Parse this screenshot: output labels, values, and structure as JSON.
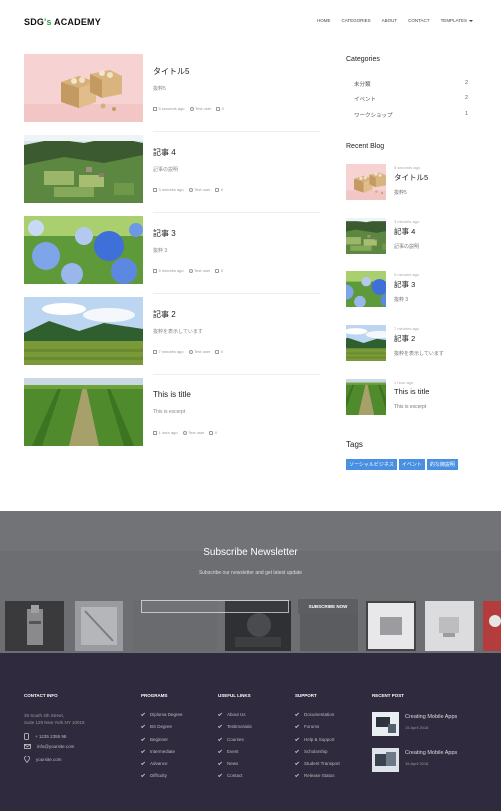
{
  "site": {
    "logo_main": "SDG",
    "logo_accent": "'s",
    "logo_rest": " ACADEMY"
  },
  "nav": [
    "HOME",
    "CATEGORIES",
    "ABOUT",
    "CONTACT",
    "TEMPLATES"
  ],
  "posts": [
    {
      "title": "タイトル5",
      "excerpt": "抜粋5",
      "ago": "5 seconds ago",
      "author": "Test user",
      "comments": "0",
      "image": "food-box-icon"
    },
    {
      "title": "記事 4",
      "excerpt": "記事の説明",
      "ago": "3 minutes ago",
      "author": "Test user",
      "comments": "0",
      "image": "village-landscape-icon"
    },
    {
      "title": "記事 3",
      "excerpt": "抜粋 3",
      "ago": "5 minutes ago",
      "author": "Test user",
      "comments": "0",
      "image": "hydrangea-icon"
    },
    {
      "title": "記事 2",
      "excerpt": "抜粋を表示しています",
      "ago": "7 minutes ago",
      "author": "Test user",
      "comments": "0",
      "image": "tea-field-icon"
    },
    {
      "title": "This is title",
      "excerpt": "This is excerpt",
      "ago": "1 hour ago",
      "author": "Test user",
      "comments": "0",
      "image": "field-rows-icon"
    }
  ],
  "sidebar": {
    "categories_heading": "Categories",
    "categories": [
      {
        "name": "未分類",
        "count": "2"
      },
      {
        "name": "イベント",
        "count": "2"
      },
      {
        "name": "ワークショップ",
        "count": "1"
      }
    ],
    "recent_heading": "Recent Blog",
    "recent": [
      {
        "ago": "5 seconds ago",
        "title": "タイトル5",
        "excerpt": "抜粋5"
      },
      {
        "ago": "3 minutes ago",
        "title": "記事 4",
        "excerpt": "記事の説明"
      },
      {
        "ago": "5 minutes ago",
        "title": "記事 3",
        "excerpt": "抜粋 3"
      },
      {
        "ago": "7 minutes ago",
        "title": "記事 2",
        "excerpt": "抜粋を表示しています"
      },
      {
        "ago": "1 hour ago",
        "title": "This is title",
        "excerpt": "This is excerpt"
      }
    ],
    "tags_heading": "Tags",
    "tags": [
      "ソーシャルビジネス",
      "イベント",
      "的な御説明"
    ]
  },
  "newsletter": {
    "heading": "Subscribe Newsletter",
    "subheading": "Subscribe our newsletter and get latest update",
    "input_placeholder": "Enter your Email",
    "button": "SUBSCRIBE NOW"
  },
  "footer": {
    "contact_heading": "CONTACT INFO",
    "address_line1": "39 South 4th Street,",
    "address_line2": "Suite 129 New York NY 10018",
    "phone": "+ 1235 2355 98",
    "email": "info@yoursite.com",
    "website": "yoursite.com",
    "programs_heading": "PROGRAMS",
    "programs": [
      "Diploma Degree",
      "BS Degree",
      "Beginner",
      "Intermediate",
      "Advance",
      "Difficulty"
    ],
    "links_heading": "USEFUL LINKS",
    "links": [
      "About Us",
      "Testimonials",
      "Courses",
      "Event",
      "News",
      "Contact"
    ],
    "support_heading": "SUPPORT",
    "support": [
      "Documentation",
      "Forums",
      "Help & Support",
      "Scholarship",
      "Student Transport",
      "Release Status"
    ],
    "recent_heading": "RECENT POST",
    "recent_posts": [
      {
        "title": "Creating Mobile Apps",
        "date": "15 April 2018"
      },
      {
        "title": "Creating Mobile Apps",
        "date": "15 April 2018"
      }
    ]
  },
  "colors": {
    "accent": "#4a90e2",
    "logo_green": "#35a04a",
    "footer_bg": "#2f2a3e",
    "newsletter_bg": "#6d6e71"
  }
}
